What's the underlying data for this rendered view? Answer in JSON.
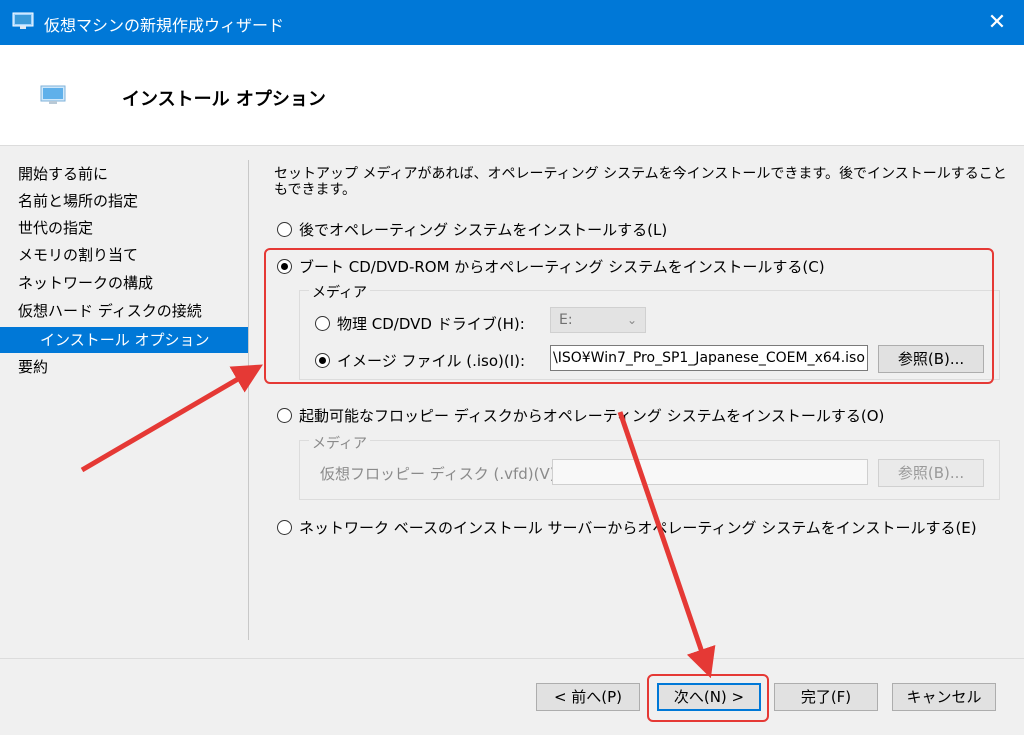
{
  "window": {
    "title": "仮想マシンの新規作成ウィザード",
    "close_glyph": "✕"
  },
  "header": {
    "title": "インストール オプション"
  },
  "nav": {
    "items": [
      {
        "label": "開始する前に"
      },
      {
        "label": "名前と場所の指定"
      },
      {
        "label": "世代の指定"
      },
      {
        "label": "メモリの割り当て"
      },
      {
        "label": "ネットワークの構成"
      },
      {
        "label": "仮想ハード ディスクの接続"
      },
      {
        "label": "インストール オプション",
        "selected": true
      },
      {
        "label": "要約"
      }
    ]
  },
  "main": {
    "intro": "セットアップ メディアがあれば、オペレーティング システムを今インストールできます。後でインストールすることもできます。",
    "option_later": {
      "label": "後でオペレーティング システムをインストールする(L)",
      "checked": false
    },
    "option_boot_cd": {
      "label": "ブート CD/DVD-ROM からオペレーティング システムをインストールする(C)",
      "checked": true,
      "media_label": "メディア",
      "physical": {
        "label": "物理 CD/DVD ドライブ(H):",
        "checked": false,
        "drive_value": "E:"
      },
      "image": {
        "label": "イメージ ファイル (.iso)(I):",
        "checked": true,
        "path_value": "\\ISO¥Win7_Pro_SP1_Japanese_COEM_x64.iso",
        "browse_label": "参照(B)..."
      }
    },
    "option_floppy": {
      "label": "起動可能なフロッピー ディスクからオペレーティング システムをインストールする(O)",
      "checked": false,
      "media_label": "メディア",
      "vfd_label": "仮想フロッピー ディスク (.vfd)(V):",
      "vfd_value": "",
      "browse_label": "参照(B)..."
    },
    "option_network": {
      "label": "ネットワーク ベースのインストール サーバーからオペレーティング システムをインストールする(E)",
      "checked": false
    }
  },
  "footer": {
    "prev_label": "< 前へ(P)",
    "next_label": "次へ(N) >",
    "finish_label": "完了(F)",
    "cancel_label": "キャンセル"
  },
  "colors": {
    "accent": "#0078d7",
    "annotation": "#e53935"
  }
}
